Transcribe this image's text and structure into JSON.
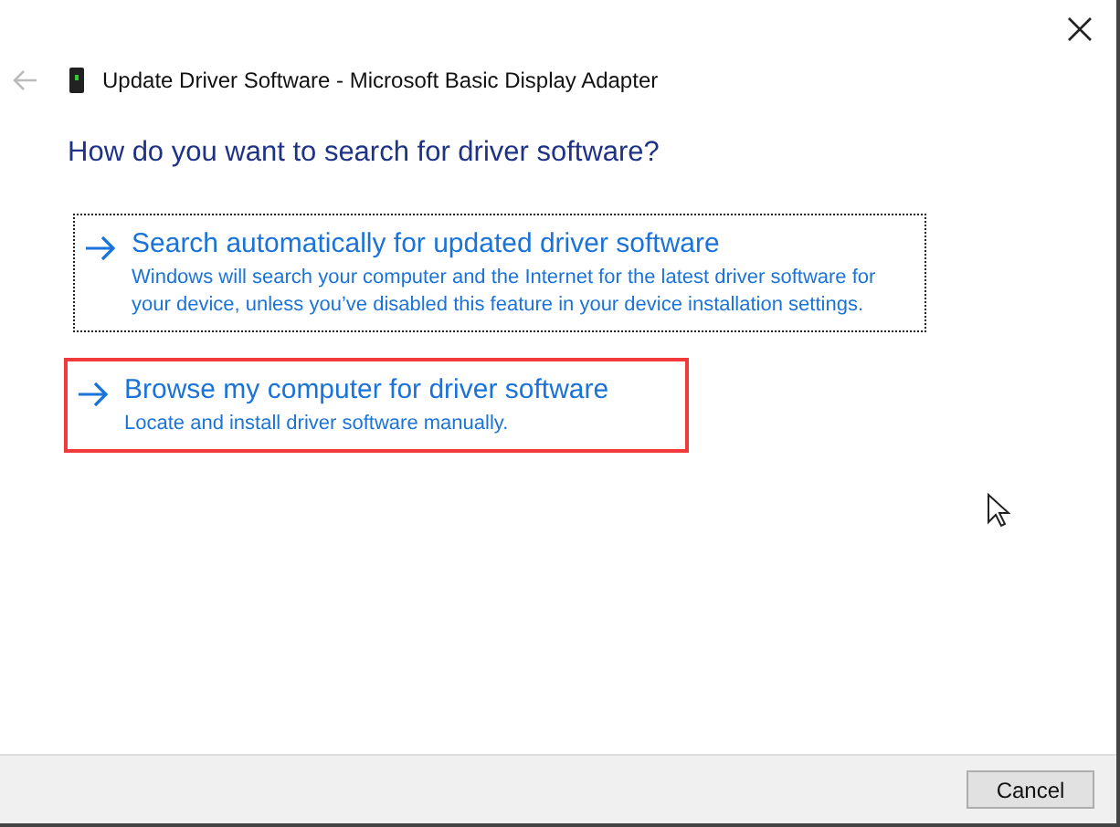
{
  "window": {
    "title": "Update Driver Software - Microsoft Basic Display Adapter"
  },
  "heading": "How do you want to search for driver software?",
  "options": [
    {
      "title": "Search automatically for updated driver software",
      "description": "Windows will search your computer and the Internet for the latest driver software for your device, unless you’ve disabled this feature in your device installation settings.",
      "focused": true,
      "highlighted": false
    },
    {
      "title": "Browse my computer for driver software",
      "description": "Locate and install driver software manually.",
      "focused": false,
      "highlighted": true
    }
  ],
  "buttons": [
    "Cancel"
  ]
}
